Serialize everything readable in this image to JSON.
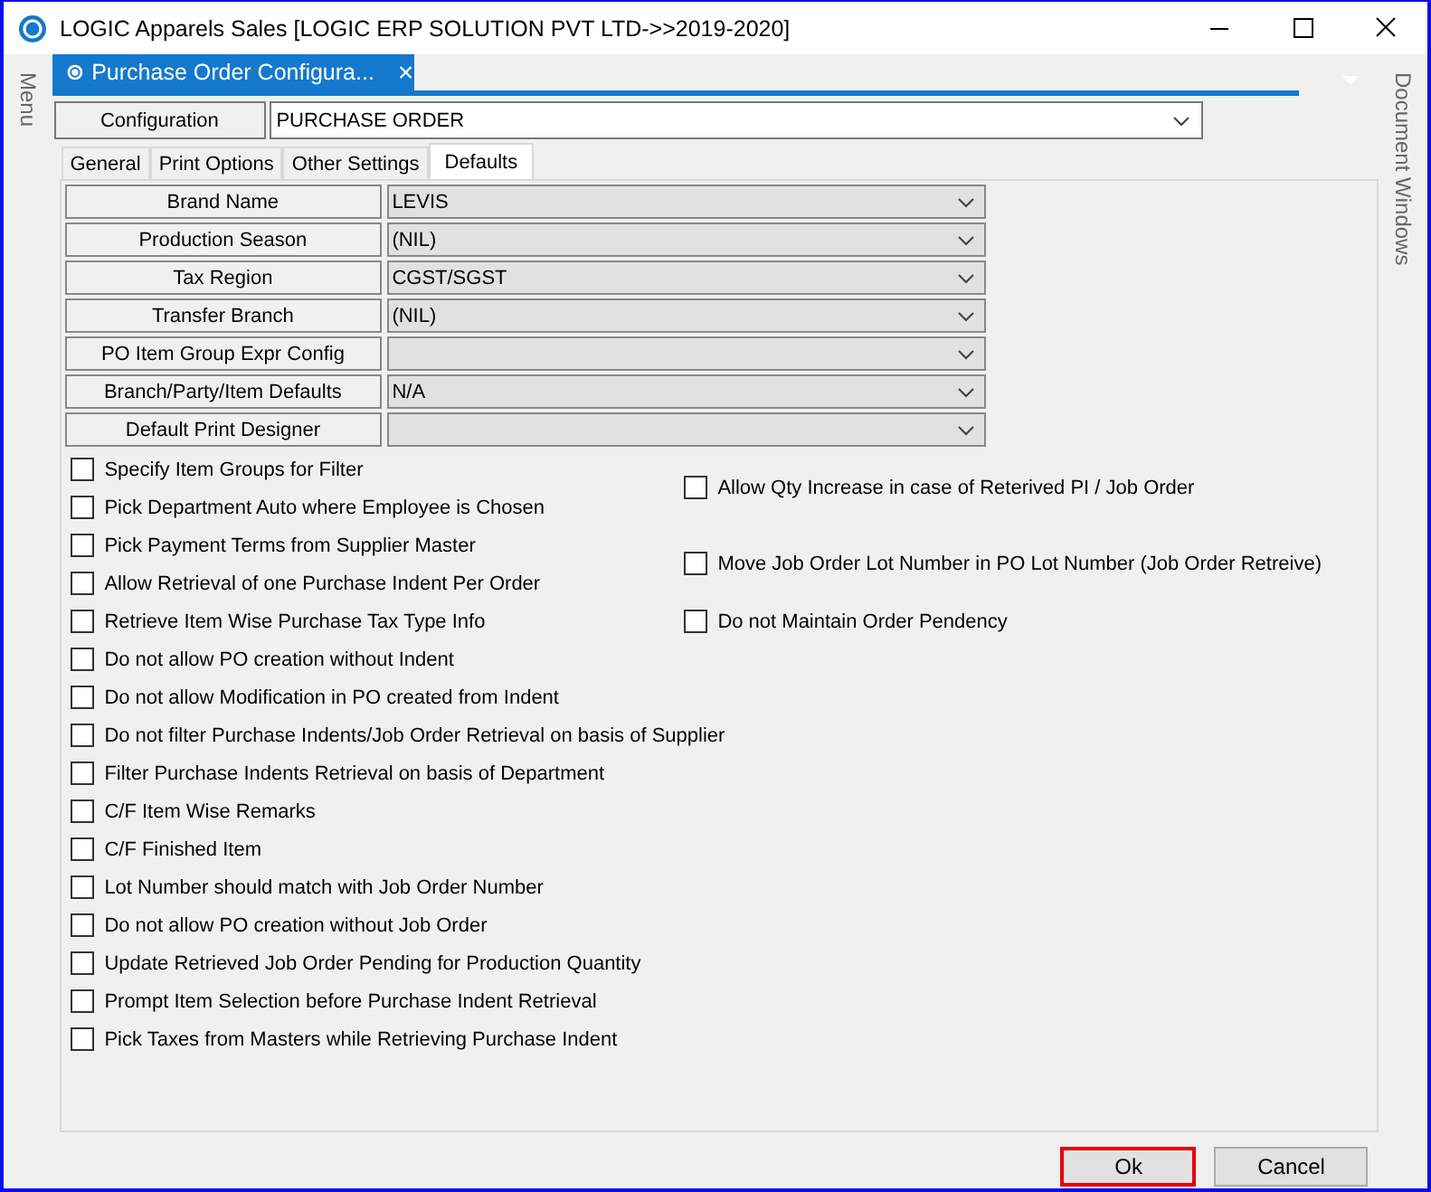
{
  "window": {
    "title": "LOGIC Apparels Sales  [LOGIC ERP SOLUTION PVT LTD->>2019-2020]"
  },
  "side_panels": {
    "left": "Menu",
    "right": "Document Windows"
  },
  "document_tab": {
    "label": "Purchase Order Configura...",
    "close": "×"
  },
  "configuration": {
    "label": "Configuration",
    "value": "PURCHASE ORDER"
  },
  "tabs": [
    {
      "label": "General",
      "selected": false
    },
    {
      "label": "Print Options",
      "selected": false
    },
    {
      "label": "Other Settings",
      "selected": false
    },
    {
      "label": "Defaults",
      "selected": true
    }
  ],
  "defaults": [
    {
      "label": "Brand Name",
      "value": "LEVIS"
    },
    {
      "label": "Production Season",
      "value": "(NIL)"
    },
    {
      "label": "Tax Region",
      "value": "CGST/SGST"
    },
    {
      "label": "Transfer Branch",
      "value": "(NIL)"
    },
    {
      "label": "PO Item Group Expr Config"
    },
    {
      "label": "Branch/Party/Item Defaults",
      "value": "N/A"
    },
    {
      "label": "Default Print Designer"
    }
  ],
  "options_left": [
    {
      "label": "Specify Item Groups for Filter",
      "checked": false
    },
    {
      "label": "Pick Department Auto where Employee is Chosen",
      "checked": false
    },
    {
      "label": "Pick Payment Terms from Supplier Master",
      "checked": false
    },
    {
      "label": "Allow Retrieval of one Purchase Indent Per Order",
      "checked": false
    },
    {
      "label": "Retrieve Item Wise Purchase Tax Type Info",
      "checked": false
    },
    {
      "label": "Do not allow PO creation without Indent",
      "checked": false
    },
    {
      "label": "Do not allow Modification in PO created from Indent",
      "checked": false
    },
    {
      "label": "Do not filter Purchase Indents/Job Order Retrieval on basis of Supplier",
      "checked": false
    },
    {
      "label": "Filter Purchase Indents Retrieval on basis of Department",
      "checked": false
    },
    {
      "label": "C/F Item Wise Remarks",
      "checked": false
    },
    {
      "label": "C/F Finished Item",
      "checked": false
    },
    {
      "label": "Lot Number should match with Job Order Number",
      "checked": false
    },
    {
      "label": "Do not allow PO creation without Job Order",
      "checked": false
    },
    {
      "label": "Update Retrieved Job Order Pending for Production Quantity",
      "checked": false
    },
    {
      "label": "Prompt Item Selection before Purchase Indent Retrieval",
      "checked": false
    },
    {
      "label": "Pick Taxes from Masters while Retrieving Purchase Indent",
      "checked": false
    }
  ],
  "options_right": [
    {
      "label": "Allow Qty Increase in case of Reterived PI / Job Order",
      "checked": false
    },
    {
      "label": "Move Job Order Lot Number in PO Lot Number (Job Order Retreive)",
      "checked": false
    },
    {
      "label": "Do not Maintain Order Pendency",
      "checked": false
    }
  ],
  "buttons": [
    {
      "label": "Ok",
      "focused": true
    },
    {
      "label": "Cancel",
      "focused": false
    }
  ]
}
